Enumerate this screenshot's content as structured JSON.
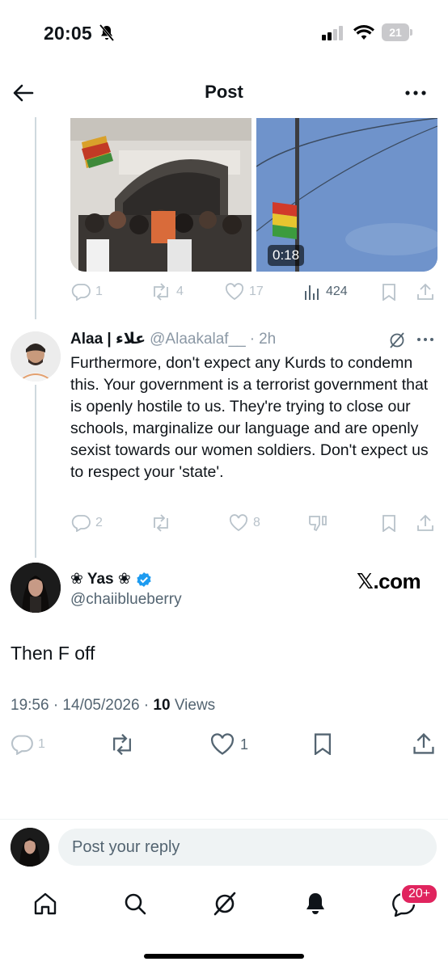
{
  "status_bar": {
    "time": "20:05",
    "battery": "21"
  },
  "header": {
    "title": "Post"
  },
  "media": {
    "video_duration": "0:18"
  },
  "parent_actions": {
    "replies": "1",
    "reposts": "4",
    "likes": "17",
    "views": "424"
  },
  "reply": {
    "name": "Alaa | علاء",
    "handle": "@Alaakalaf__",
    "separator": "·",
    "time": "2h",
    "text": "Furthermore, don't expect any Kurds to condemn this. Your government is a terrorist government that is openly hostile to us. They're trying to close our schools, marginalize our language and are openly sexist towards our women soldiers. Don't expect us to respect your 'state'.",
    "replies": "2",
    "likes": "8"
  },
  "main_post": {
    "name": "❀ Yas ❀",
    "handle": "@chaiiblueberry",
    "brand": "𝕏.com",
    "text": "Then F off",
    "timestamp": "19:56 · 14/05/2026 · ",
    "views_count": "10",
    "views_label": " Views",
    "replies": "1",
    "likes": "1"
  },
  "composer": {
    "placeholder": "Post your reply"
  },
  "bottom_nav": {
    "messages_badge": "20+"
  },
  "colors": {
    "verified": "#1d9bf0",
    "badge": "#e0245e",
    "muted_text": "#536471"
  }
}
